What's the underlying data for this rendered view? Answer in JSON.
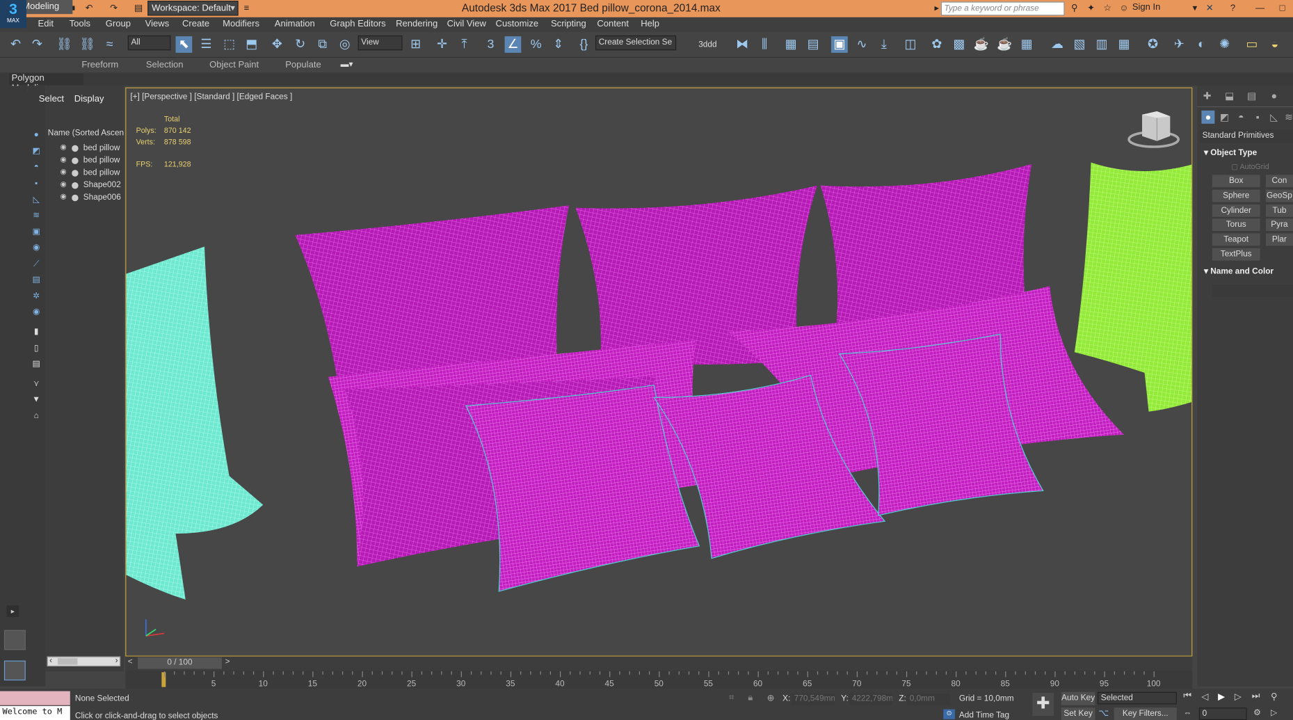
{
  "app": {
    "title": "Autodesk 3ds Max 2017    Bed pillow_corona_2014.max",
    "logo_num": "3",
    "logo_text": "MAX"
  },
  "titlebar": {
    "workspace": "Workspace: Default",
    "search_placeholder": "Type a keyword or phrase",
    "sign_in": "Sign In"
  },
  "menu": [
    "Edit",
    "Tools",
    "Group",
    "Views",
    "Create",
    "Modifiers",
    "Animation",
    "Graph Editors",
    "Rendering",
    "Civil View",
    "Customize",
    "Scripting",
    "Content",
    "Help"
  ],
  "toolbar": {
    "filter": "All",
    "ref_coord": "View",
    "selection_set": "Create Selection Se",
    "label_3ddd": "3ddd"
  },
  "ribbon": {
    "tabs": [
      "Modeling",
      "Freeform",
      "Selection",
      "Object Paint",
      "Populate"
    ],
    "panel": "Polygon Modeling"
  },
  "explorer": {
    "tabs": [
      "Select",
      "Display"
    ],
    "header": "Name (Sorted Ascend",
    "items": [
      "bed pillow",
      "bed pillow",
      "bed pillow",
      "Shape002",
      "Shape006"
    ]
  },
  "viewport": {
    "label": "[+] [Perspective ] [Standard ] [Edged Faces ]",
    "stats_header": "Total",
    "polys_label": "Polys:",
    "polys": "870 142",
    "verts_label": "Verts:",
    "verts": "878 598",
    "fps_label": "FPS:",
    "fps": "121,928",
    "colors": {
      "pillow": "#c21fc0",
      "cyan": "#6df0d8",
      "green": "#9ef03a",
      "bg": "#474747"
    }
  },
  "command_panel": {
    "category": "Standard Primitives",
    "object_type": "Object Type",
    "autogrid": "AutoGrid",
    "buttons_left": [
      "Box",
      "Sphere",
      "Cylinder",
      "Torus",
      "Teapot",
      "TextPlus"
    ],
    "buttons_right": [
      "Con",
      "GeoSp",
      "Tub",
      "Pyra",
      "Plar"
    ],
    "name_color": "Name and Color"
  },
  "timeline": {
    "frame": "0 / 100",
    "ticks": [
      "5",
      "10",
      "15",
      "20",
      "25",
      "30",
      "35",
      "40",
      "45",
      "50",
      "55",
      "60",
      "65",
      "70",
      "75",
      "80",
      "85",
      "90",
      "95",
      "100"
    ]
  },
  "status": {
    "maxscript": "Welcome to M",
    "selection": "None Selected",
    "prompt": "Click or click-and-drag to select objects",
    "x_label": "X:",
    "x": "770,549mm",
    "y_label": "Y:",
    "y": "4222,798m",
    "z_label": "Z:",
    "z": "0,0mm",
    "grid": "Grid = 10,0mm",
    "add_time_tag": "Add Time Tag",
    "auto_key": "Auto Key",
    "set_key": "Set Key",
    "key_mode": "Selected",
    "key_filters": "Key Filters...",
    "frame_field": "0"
  }
}
